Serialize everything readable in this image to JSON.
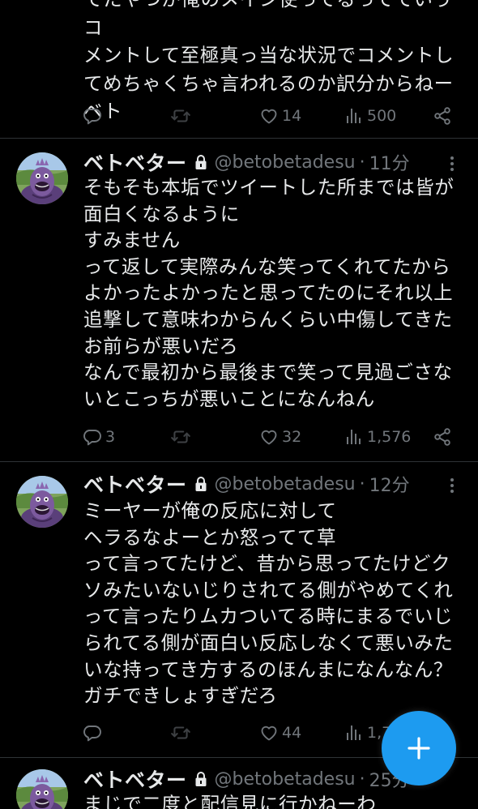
{
  "colors": {
    "background": "#000000",
    "text": "#e7e9ea",
    "muted": "#71767b",
    "divider": "#2f3336",
    "accent": "#1d9bf0"
  },
  "tweets": [
    {
      "text": "てたやつが俺のメイン使ってるってていうコ\nメントして至極真っ当な状況でコメントし\nてめちゃくちゃ言われるのか訳分からねー\nベト",
      "replies": "",
      "likes": "14",
      "views": "500"
    },
    {
      "name": "ベトベター",
      "handle": "@betobetadesu",
      "separator": "·",
      "time": "11分",
      "text": "そもそも本垢でツイートした所までは皆が\n面白くなるように\nすみません\nって返して実際みんな笑ってくれてたから\nよかったよかったと思ってたのにそれ以上\n追撃して意味わからんくらい中傷してきた\nお前らが悪いだろ\nなんで最初から最後まで笑って見過ごさな\nいとこっちが悪いことになんねん",
      "replies": "3",
      "likes": "32",
      "views": "1,576"
    },
    {
      "name": "ベトベター",
      "handle": "@betobetadesu",
      "separator": "·",
      "time": "12分",
      "text": "ミーヤーが俺の反応に対して\nヘラるなよーとか怒ってて草\nって言ってたけど、昔から思ってたけどク\nソみたいないじりされてる側がやめてくれ\nって言ったりムカついてる時にまるでいじ\nられてる側が面白い反応しなくて悪いみた\nいな持ってき方するのほんまになんなん？\nガチできしょすぎだろ",
      "replies": "",
      "likes": "44",
      "views": "1,7"
    },
    {
      "name": "ベトベター",
      "handle": "@betobetadesu",
      "separator": "·",
      "time": "25分",
      "text": "まじで二度と配信見に行かねーわ"
    }
  ],
  "icons": {
    "reply": "reply-icon",
    "retweet": "retweet-icon",
    "like": "heart-icon",
    "views": "views-icon",
    "share": "share-icon",
    "lock": "lock-icon",
    "more": "more-dots-icon",
    "compose": "plus-icon"
  }
}
